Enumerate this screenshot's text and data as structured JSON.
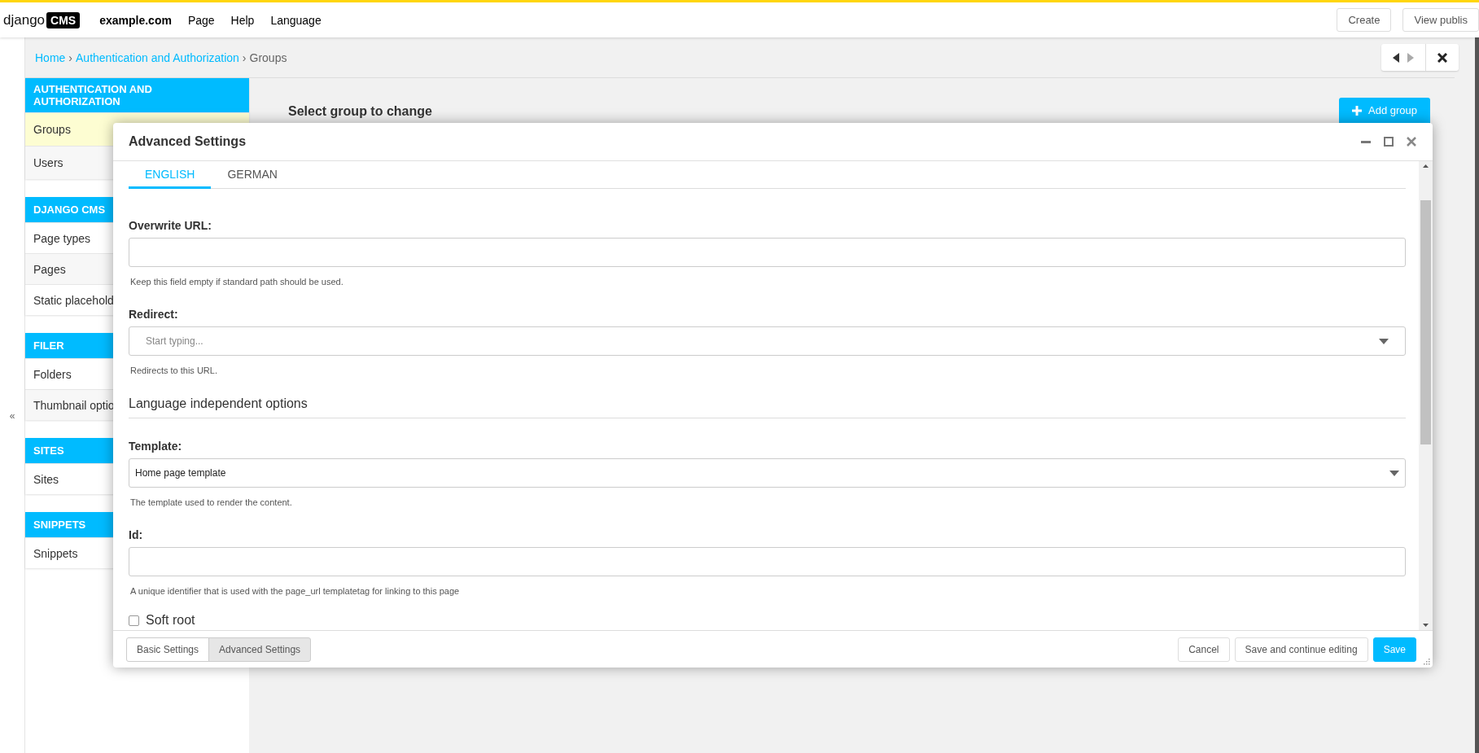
{
  "toolbar": {
    "logo": {
      "text": "django",
      "badge": "CMS"
    },
    "site": "example.com",
    "menu": [
      "Page",
      "Help",
      "Language"
    ],
    "buttons": [
      {
        "label": "Create"
      },
      {
        "label": "View publis"
      }
    ]
  },
  "breadcrumb": [
    {
      "kind": "link",
      "text": "Home"
    },
    {
      "kind": "sep",
      "text": "›"
    },
    {
      "kind": "link",
      "text": "Authentication and Authorization"
    },
    {
      "kind": "sep",
      "text": "›"
    },
    {
      "kind": "current",
      "text": "Groups"
    }
  ],
  "collapse": "«",
  "sidebar": [
    {
      "title": "AUTHENTICATION AND AUTHORIZATION",
      "items": [
        {
          "label": "Groups",
          "selected": true
        },
        {
          "label": "Users",
          "selected": false
        }
      ]
    },
    {
      "title": "DJANGO CMS",
      "items": [
        {
          "label": "Page types",
          "selected": false
        },
        {
          "label": "Pages",
          "selected": false
        },
        {
          "label": "Static placehold",
          "selected": false
        }
      ]
    },
    {
      "title": "FILER",
      "items": [
        {
          "label": "Folders",
          "selected": false
        },
        {
          "label": "Thumbnail optio",
          "selected": false
        }
      ]
    },
    {
      "title": "SITES",
      "items": [
        {
          "label": "Sites",
          "selected": false
        }
      ]
    },
    {
      "title": "SNIPPETS",
      "items": [
        {
          "label": "Snippets",
          "selected": false
        }
      ]
    }
  ],
  "content": {
    "title": "Select group to change",
    "add_button": "Add group"
  },
  "modal": {
    "title": "Advanced Settings",
    "tabs": [
      {
        "label": "ENGLISH",
        "selected": true
      },
      {
        "label": "GERMAN",
        "selected": false
      }
    ],
    "fields": [
      {
        "kind": "text",
        "label": "Overwrite URL:",
        "help": "Keep this field empty if standard path should be used."
      },
      {
        "kind": "select",
        "label": "Redirect:",
        "placeholder": "Start typing...",
        "help": "Redirects to this URL."
      },
      {
        "kind": "heading",
        "text": "Language independent options"
      },
      {
        "kind": "select",
        "label": "Template:",
        "value": "Home page template",
        "help": "The template used to render the content."
      },
      {
        "kind": "text",
        "label": "Id:",
        "help": "A unique identifier that is used with the page_url templatetag for linking to this page"
      },
      {
        "kind": "checkbox",
        "label": "Soft root",
        "checked": false
      }
    ],
    "footer_tabs": [
      {
        "label": "Basic Settings",
        "selected": false
      },
      {
        "label": "Advanced Settings",
        "selected": true
      }
    ],
    "buttons": [
      {
        "label": "Cancel",
        "kind": "default"
      },
      {
        "label": "Save and continue editing",
        "kind": "default"
      },
      {
        "label": "Save",
        "kind": "primary"
      }
    ]
  }
}
